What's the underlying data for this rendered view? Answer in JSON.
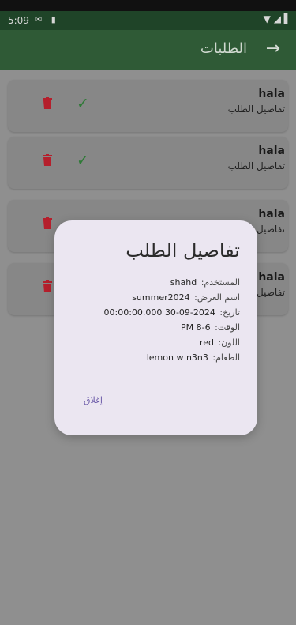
{
  "status_bar": {
    "time": "5:09",
    "left_icons": [
      "mail-icon",
      "sd-card-icon"
    ],
    "right_icons": [
      "wifi-icon",
      "signal-icon",
      "battery-icon"
    ]
  },
  "app_bar": {
    "title": "الطلبات",
    "back_icon": "arrow-right-icon"
  },
  "orders": [
    {
      "name": "hala",
      "subtitle": "تفاصيل الطلب",
      "show_actions": true
    },
    {
      "name": "hala",
      "subtitle": "تفاصيل الطلب",
      "show_actions": true
    },
    {
      "name": "hala",
      "subtitle": "تفاصيل الطلب",
      "show_actions": false
    },
    {
      "name": "hala",
      "subtitle": "تفاصيل الطلب",
      "show_actions": false
    }
  ],
  "dialog": {
    "title": "تفاصيل الطلب",
    "rows": [
      {
        "label": "المستخدم:",
        "value": "shahd"
      },
      {
        "label": "اسم العرض:",
        "value": "summer2024"
      },
      {
        "label": "تاريخ:",
        "value": "2024-09-30 00:00:00.000"
      },
      {
        "label": "الوقت:",
        "value": "6-8 PM"
      },
      {
        "label": "اللون:",
        "value": "red"
      },
      {
        "label": "الطعام:",
        "value": "lemon w n3n3"
      }
    ],
    "close_label": "إغلاق"
  },
  "colors": {
    "appbar": "#2f5a36",
    "status_bar": "#1f4428",
    "delete": "#b51f2c",
    "check": "#2f7a37",
    "dialog_background": "#ebe6f1",
    "button_text": "#6b5aa8"
  }
}
